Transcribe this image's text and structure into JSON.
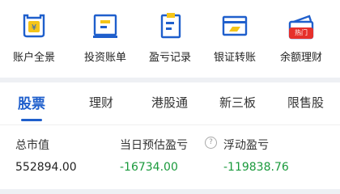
{
  "shortcuts": [
    {
      "label": "账户全景",
      "icon": "account-overview-icon"
    },
    {
      "label": "投资账单",
      "icon": "investment-bill-icon"
    },
    {
      "label": "盈亏记录",
      "icon": "profit-loss-record-icon"
    },
    {
      "label": "银证转账",
      "icon": "bank-transfer-icon"
    },
    {
      "label": "余额理财",
      "icon": "balance-wealth-icon",
      "badge": "热门"
    }
  ],
  "tabs": [
    {
      "label": "股票",
      "active": true
    },
    {
      "label": "理财"
    },
    {
      "label": "港股通"
    },
    {
      "label": "新三板"
    },
    {
      "label": "限售股"
    }
  ],
  "summary": {
    "total_market_value": {
      "label": "总市值",
      "value": "552894.00"
    },
    "today_estimated_pnl": {
      "label": "当日预估盈亏",
      "value": "-16734.00"
    },
    "floating_pnl": {
      "label": "浮动盈亏",
      "value": "-119838.76"
    }
  },
  "colors": {
    "icon_blue": "#1f5fcc",
    "icon_yellow": "#f5c518",
    "badge_red": "#e6302b",
    "loss_green": "#1a9a3c",
    "active_tab": "#1f5fcc"
  }
}
